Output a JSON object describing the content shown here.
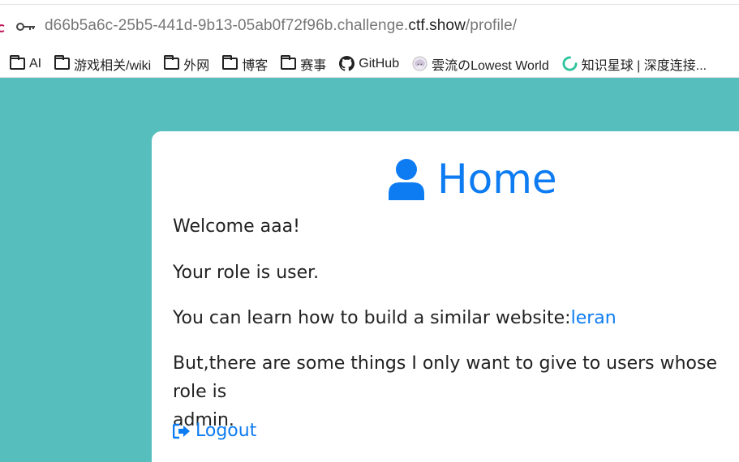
{
  "browser": {
    "url_prefix": "d66b5a6c-25b5-441d-9b13-05ab0f72f96b.challenge.",
    "url_host": "ctf.show",
    "url_path": "/profile/"
  },
  "bookmarks": [
    {
      "label": "AI",
      "icon": "folder-icon"
    },
    {
      "label": "游戏相关/wiki",
      "icon": "folder-icon"
    },
    {
      "label": "外网",
      "icon": "folder-icon"
    },
    {
      "label": "博客",
      "icon": "folder-icon"
    },
    {
      "label": "赛事",
      "icon": "folder-icon"
    },
    {
      "label": "GitHub",
      "icon": "github-icon"
    },
    {
      "label": "雲流のLowest World",
      "icon": "anime-avatar-icon"
    },
    {
      "label": "知识星球 | 深度连接...",
      "icon": "planet-ring-icon"
    }
  ],
  "page": {
    "title": "Home",
    "welcome": "Welcome aaa!",
    "role": "Your role is user.",
    "learn_text": "You can learn how to build a similar website:",
    "learn_link": "leran",
    "admin_line1": "But,there are some things I only want to give to users whose role is",
    "admin_line2": "admin.",
    "logout": "Logout"
  },
  "colors": {
    "background": "#56bfbd",
    "accent": "#0d7cf2"
  }
}
